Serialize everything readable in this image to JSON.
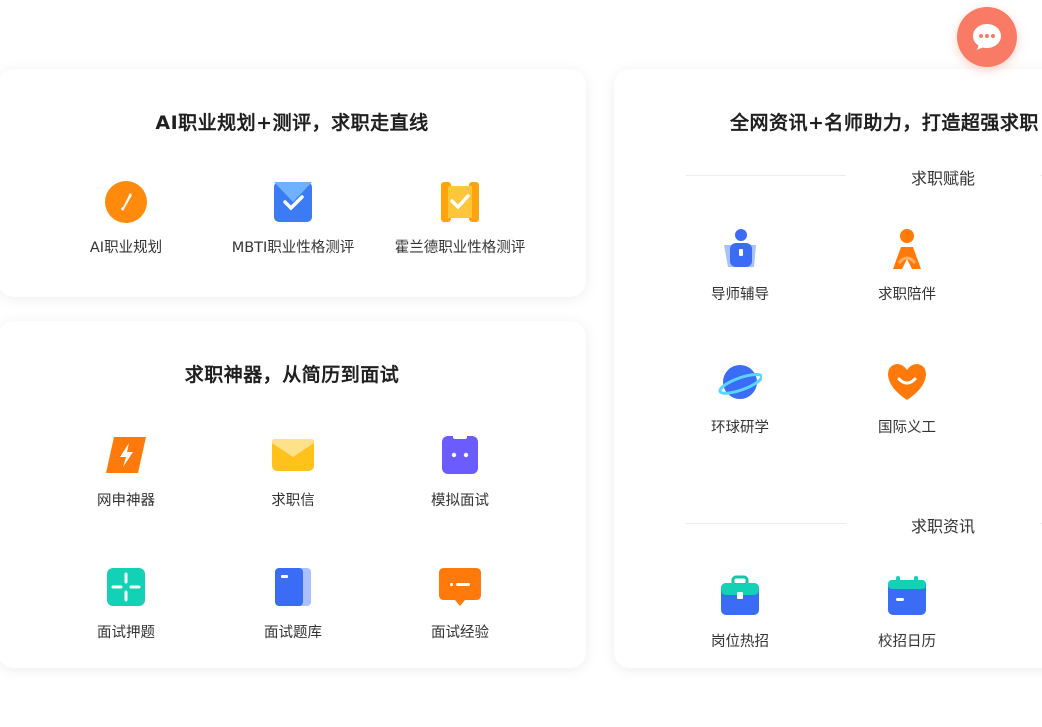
{
  "card_ai": {
    "title": "AI职业规划+测评，求职走直线",
    "items": [
      {
        "label": "AI职业规划",
        "icon": "compass-icon"
      },
      {
        "label": "MBTI职业性格测评",
        "icon": "mbti-test-icon"
      },
      {
        "label": "霍兰德职业性格测评",
        "icon": "holland-test-icon"
      }
    ]
  },
  "card_tools": {
    "title": "求职神器，从简历到面试",
    "items": [
      {
        "label": "网申神器",
        "icon": "lightning-icon"
      },
      {
        "label": "求职信",
        "icon": "envelope-icon"
      },
      {
        "label": "模拟面试",
        "icon": "robot-icon"
      },
      {
        "label": "面试押题",
        "icon": "crosshair-icon"
      },
      {
        "label": "面试题库",
        "icon": "book-icon"
      },
      {
        "label": "面试经验",
        "icon": "speech-bubble-icon"
      }
    ]
  },
  "card_right": {
    "title": "全网资讯+名师助力，打造超强求职",
    "section1": {
      "title": "求职赋能",
      "items": [
        {
          "label": "导师辅导",
          "icon": "mentor-icon"
        },
        {
          "label": "求职陪伴",
          "icon": "companion-icon"
        },
        {
          "label": "环球研学",
          "icon": "planet-icon"
        },
        {
          "label": "国际义工",
          "icon": "heart-icon"
        }
      ]
    },
    "section2": {
      "title": "求职资讯",
      "items": [
        {
          "label": "岗位热招",
          "icon": "briefcase-icon"
        },
        {
          "label": "校招日历",
          "icon": "calendar-icon"
        }
      ]
    }
  },
  "colors": {
    "orange": "#ff7a0a",
    "blue": "#3b6cf6",
    "yellow": "#ffc21c",
    "purple": "#6a5cff",
    "teal": "#12d1b4",
    "chat": "#fa7b65"
  }
}
